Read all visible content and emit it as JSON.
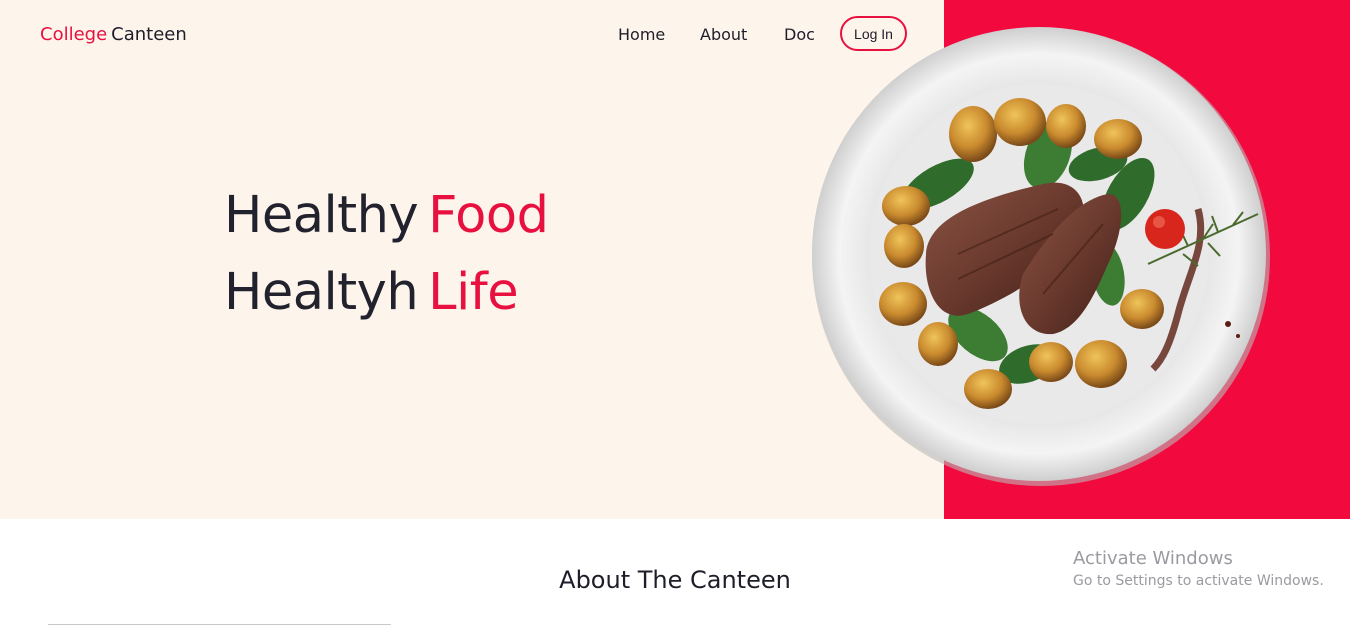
{
  "header": {
    "logo_accent": "College",
    "logo_main": "Canteen",
    "nav": [
      "Home",
      "About",
      "Doc"
    ],
    "login_label": "Log In"
  },
  "hero": {
    "line1_main": "Healthy",
    "line1_accent": "Food",
    "line2_main": "Healtyh",
    "line2_accent": "Life",
    "image_subject": "steak-potatoes-plate"
  },
  "about": {
    "title": "About The Canteen"
  },
  "os_watermark": {
    "title": "Activate Windows",
    "subtitle": "Go to Settings to activate Windows."
  },
  "colors": {
    "accent": "#e8103e",
    "panel_red": "#f20a3e",
    "hero_bg": "#fdf4ec",
    "text_dark": "#1e1e2a"
  }
}
